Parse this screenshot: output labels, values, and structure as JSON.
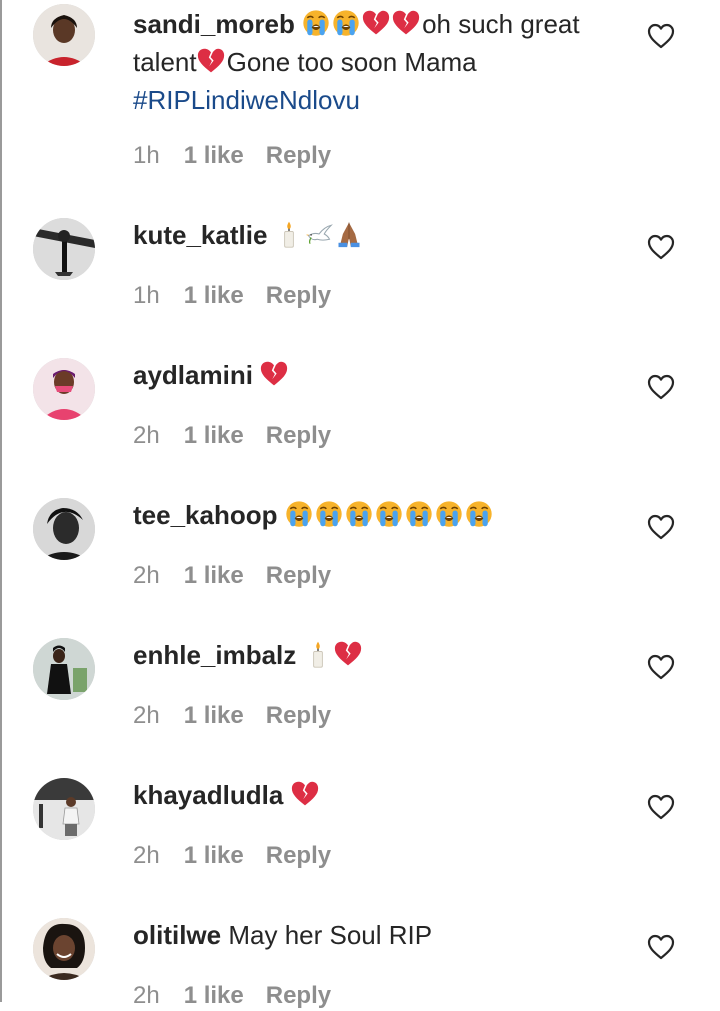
{
  "comments": [
    {
      "username": "sandi_moreb",
      "line1_emojis": [
        "loudly-crying-face",
        "loudly-crying-face",
        "broken-heart",
        "broken-heart"
      ],
      "line1_text": "oh such great",
      "line2_text_a": "talent",
      "line2_emoji": "broken-heart",
      "line2_text_b": "Gone too soon Mama",
      "hashtag": "#RIPLindiweNdlovu",
      "time": "1h",
      "likes": "1 like",
      "reply": "Reply"
    },
    {
      "username": "kute_katlie",
      "emojis": [
        "candle",
        "dove",
        "folded-hands"
      ],
      "time": "1h",
      "likes": "1 like",
      "reply": "Reply"
    },
    {
      "username": "aydlamini",
      "emojis": [
        "broken-heart"
      ],
      "time": "2h",
      "likes": "1 like",
      "reply": "Reply"
    },
    {
      "username": "tee_kahoop",
      "emojis": [
        "loudly-crying-face",
        "loudly-crying-face",
        "loudly-crying-face",
        "loudly-crying-face",
        "loudly-crying-face",
        "loudly-crying-face",
        "loudly-crying-face"
      ],
      "time": "2h",
      "likes": "1 like",
      "reply": "Reply"
    },
    {
      "username": "enhle_imbalz",
      "emojis": [
        "candle",
        "broken-heart"
      ],
      "time": "2h",
      "likes": "1 like",
      "reply": "Reply"
    },
    {
      "username": "khayadludla",
      "emojis": [
        "broken-heart"
      ],
      "time": "2h",
      "likes": "1 like",
      "reply": "Reply"
    },
    {
      "username": "olitilwe",
      "text": "May her Soul RIP",
      "time": "2h",
      "likes": "1 like",
      "reply": "Reply"
    }
  ],
  "icons": {
    "like": "heart-outline-icon"
  },
  "colors": {
    "text": "#262626",
    "meta": "#8e8e8e",
    "hashtag": "#1a4a8a",
    "heart_red": "#dd2e44",
    "crying_yellow": "#f7b32b"
  }
}
